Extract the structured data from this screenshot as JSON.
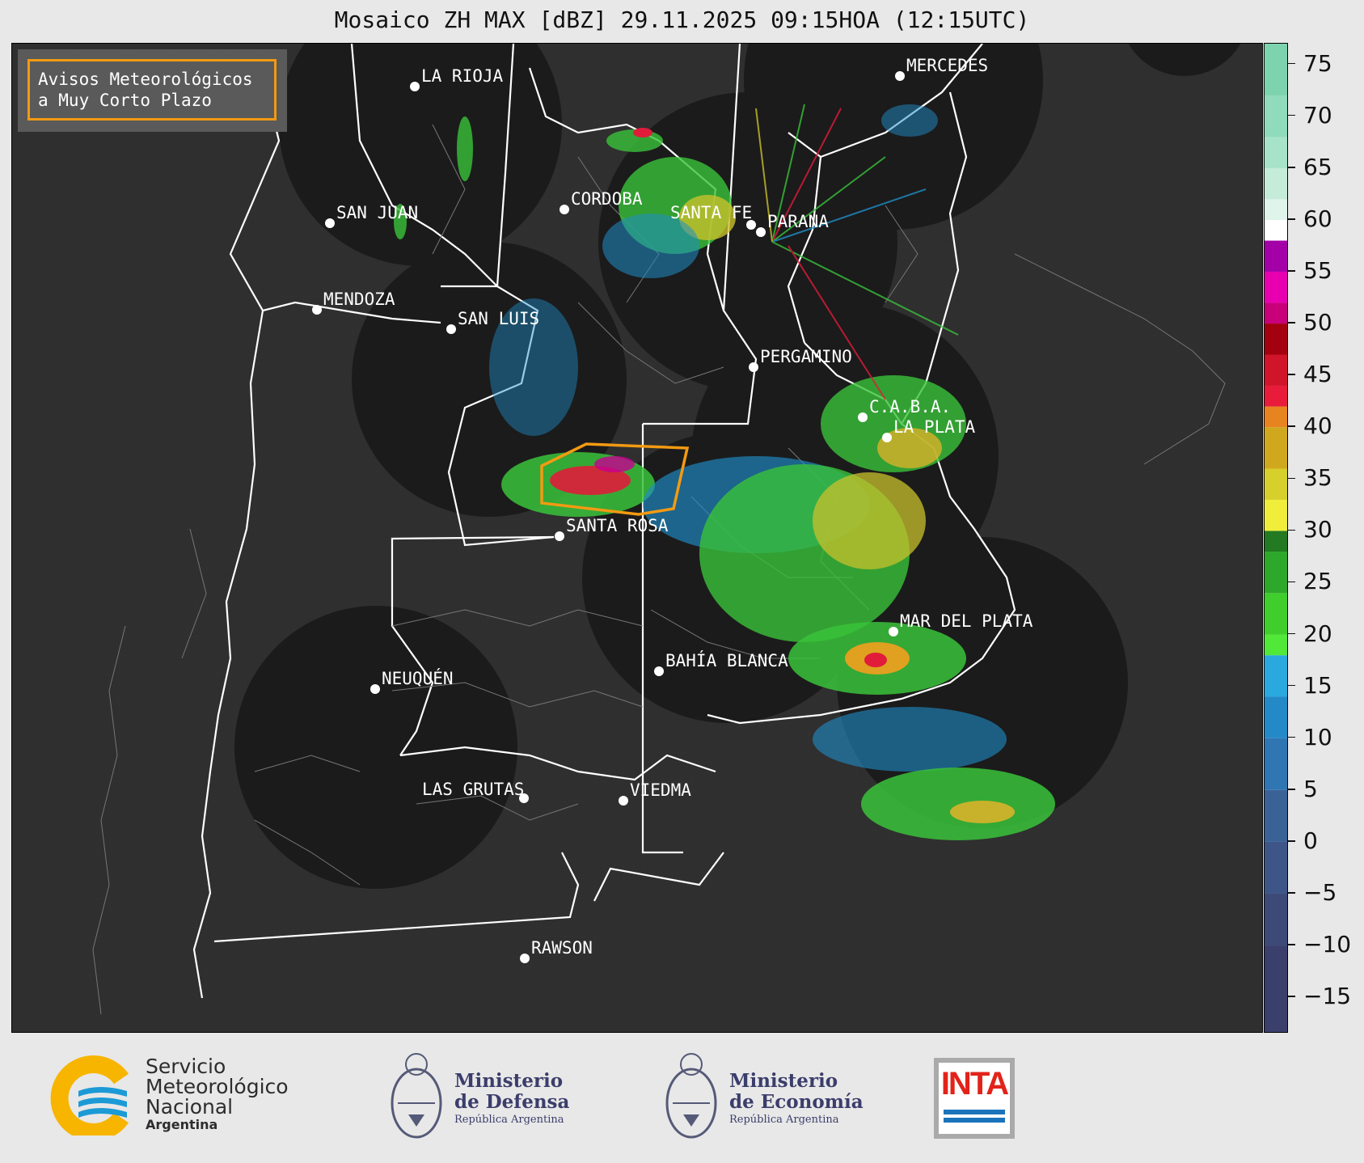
{
  "title": "Mosaico ZH MAX [dBZ] 29.11.2025 09:15HOA (12:15UTC)",
  "legend": {
    "line1": "Avisos Meteorológicos",
    "line2": "a Muy Corto Plazo",
    "border_color": "#f39a12"
  },
  "colorbar": {
    "ticks": [
      "75",
      "70",
      "65",
      "60",
      "55",
      "50",
      "45",
      "40",
      "35",
      "30",
      "25",
      "20",
      "15",
      "10",
      "5",
      "0",
      "−5",
      "−10",
      "−15"
    ],
    "tick_values": [
      75,
      70,
      65,
      60,
      55,
      50,
      45,
      40,
      35,
      30,
      25,
      20,
      15,
      10,
      5,
      0,
      -5,
      -10,
      -15
    ],
    "range": [
      -18.5,
      77
    ]
  },
  "cities": [
    {
      "name": "LA RIOJA"
    },
    {
      "name": "MERCEDES"
    },
    {
      "name": "CORDOBA"
    },
    {
      "name": "SAN JUAN"
    },
    {
      "name": "SANTA FE"
    },
    {
      "name": "PARANA"
    },
    {
      "name": "MENDOZA"
    },
    {
      "name": "SAN LUIS"
    },
    {
      "name": "PERGAMINO"
    },
    {
      "name": "C.A.B.A."
    },
    {
      "name": "LA PLATA"
    },
    {
      "name": "SANTA ROSA"
    },
    {
      "name": "MAR DEL PLATA"
    },
    {
      "name": "BAHÍA BLANCA"
    },
    {
      "name": "NEUQUÉN"
    },
    {
      "name": "LAS GRUTAS"
    },
    {
      "name": "VIEDMA"
    },
    {
      "name": "RAWSON"
    }
  ],
  "footer": {
    "smn": {
      "line1": "Servicio",
      "line2": "Meteorológico",
      "line3": "Nacional",
      "line4": "Argentina"
    },
    "defensa": {
      "line1": "Ministerio",
      "line2": "de Defensa",
      "line3": "República Argentina"
    },
    "economia": {
      "line1": "Ministerio",
      "line2": "de Economía",
      "line3": "República Argentina"
    },
    "inta": {
      "label": "INTA"
    }
  }
}
